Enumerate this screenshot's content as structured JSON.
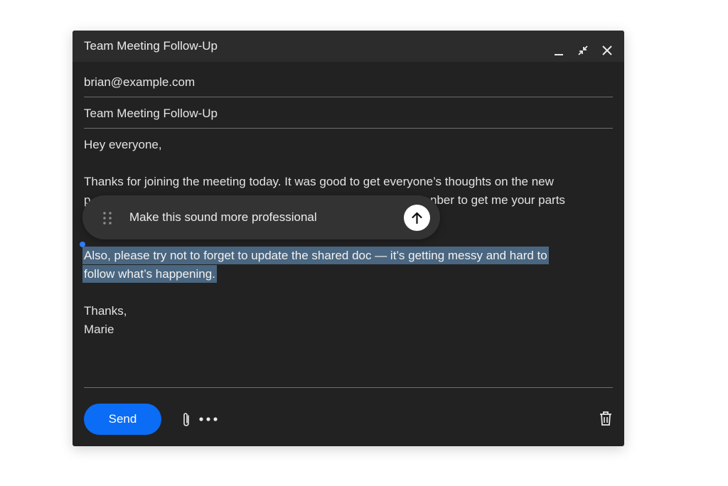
{
  "window": {
    "title": "Team Meeting Follow-Up"
  },
  "icons": {
    "minimize": "minimize-icon",
    "collapse": "collapse-icon",
    "close": "close-icon",
    "drag": "drag-handle-icon",
    "submit": "arrow-up-icon",
    "attach": "paperclip-icon",
    "more": "more-icon",
    "trash": "trash-icon"
  },
  "compose": {
    "to": "brian@example.com",
    "subject": "Team Meeting Follow-Up",
    "body": {
      "greeting": "Hey everyone,",
      "para1_line1": "Thanks for joining the meeting today. It was good to get everyone’s thoughts on the new",
      "para1_line2_visible_start": "p",
      "para1_line2_visible_end": "nber to get me your parts",
      "para2_line1": "Also, please try not to forget to update the shared doc — it’s getting messy and hard to",
      "para2_line2": "follow what’s happening.",
      "signoff": "Thanks,",
      "signature": "Marie"
    }
  },
  "ai_prompt": {
    "text": "Make this sound more professional"
  },
  "toolbar": {
    "send_label": "Send"
  },
  "colors": {
    "window_bg": "#222222",
    "titlebar_bg": "#2c2c2c",
    "accent": "#0b6cf5",
    "selection": "#4a6680"
  }
}
